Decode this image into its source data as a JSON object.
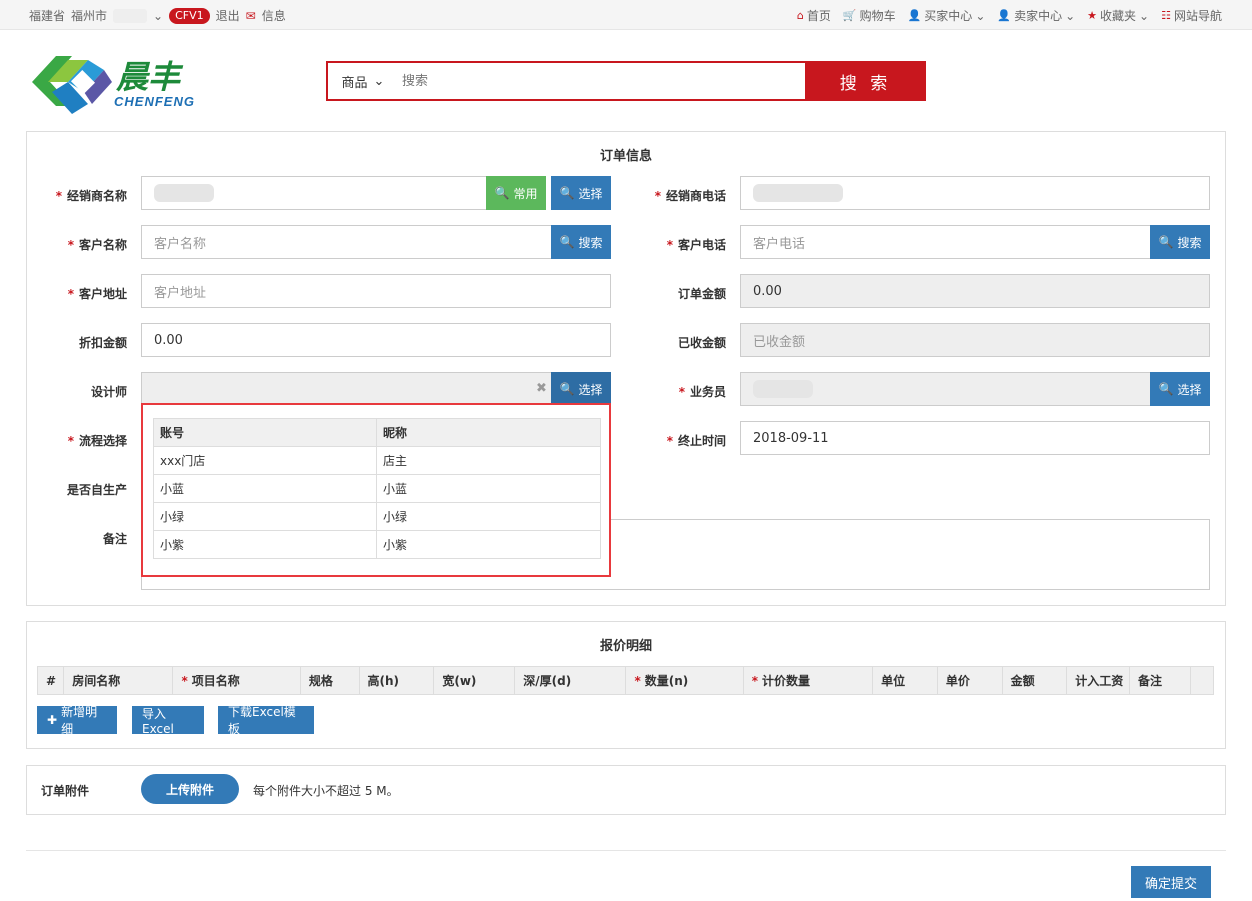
{
  "topbar": {
    "province": "福建省",
    "city": "福州市",
    "badge": "CFV1",
    "logout": "退出",
    "message": "信息",
    "nav": [
      {
        "icon": "home-icon",
        "glyph": "⌂",
        "label": "首页"
      },
      {
        "icon": "cart-icon",
        "glyph": "🛒",
        "label": "购物车"
      },
      {
        "icon": "user-icon",
        "glyph": "👤",
        "label": "买家中心"
      },
      {
        "icon": "user-icon",
        "glyph": "👤",
        "label": "卖家中心"
      },
      {
        "icon": "star-icon",
        "glyph": "★",
        "label": "收藏夹"
      },
      {
        "icon": "grid-icon",
        "glyph": "☷",
        "label": "网站导航"
      }
    ]
  },
  "logo": {
    "cn": "晨丰",
    "en": "CHENFENG"
  },
  "search": {
    "category": "商品",
    "placeholder": "搜索",
    "button": "搜 索"
  },
  "order": {
    "title": "订单信息",
    "dealer_name_label": "经销商名称",
    "dealer_common_btn": "常用",
    "dealer_select_btn": "选择",
    "dealer_phone_label": "经销商电话",
    "customer_name_label": "客户名称",
    "customer_name_placeholder": "客户名称",
    "customer_search_btn": "搜索",
    "customer_phone_label": "客户电话",
    "customer_phone_placeholder": "客户电话",
    "customer_phone_search_btn": "搜索",
    "customer_addr_label": "客户地址",
    "customer_addr_placeholder": "客户地址",
    "order_amount_label": "订单金额",
    "order_amount_value": "0.00",
    "discount_label": "折扣金额",
    "discount_value": "0.00",
    "received_label": "已收金额",
    "received_placeholder": "已收金额",
    "designer_label": "设计师",
    "designer_select_btn": "选择",
    "salesman_label": "业务员",
    "salesman_select_btn": "选择",
    "flow_label": "流程选择",
    "end_time_label": "终止时间",
    "end_time_value": "2018-09-11",
    "self_produce_label": "是否自生产",
    "remark_label": "备注"
  },
  "designer_dropdown": {
    "headers": [
      "账号",
      "昵称"
    ],
    "rows": [
      [
        "xxx门店",
        "店主"
      ],
      [
        "小蓝",
        "小蓝"
      ],
      [
        "小绿",
        "小绿"
      ],
      [
        "小紫",
        "小紫"
      ]
    ]
  },
  "quote": {
    "title": "报价明细",
    "columns": [
      {
        "label": "#",
        "req": false
      },
      {
        "label": "房间名称",
        "req": false
      },
      {
        "label": "项目名称",
        "req": true
      },
      {
        "label": "规格",
        "req": false
      },
      {
        "label": "高(h)",
        "req": false
      },
      {
        "label": "宽(w)",
        "req": false
      },
      {
        "label": "深/厚(d)",
        "req": false
      },
      {
        "label": "数量(n)",
        "req": true
      },
      {
        "label": "计价数量",
        "req": true
      },
      {
        "label": "单位",
        "req": false
      },
      {
        "label": "单价",
        "req": false
      },
      {
        "label": "金额",
        "req": false
      },
      {
        "label": "计入工资",
        "req": false
      },
      {
        "label": "备注",
        "req": false
      },
      {
        "label": "",
        "req": false
      }
    ],
    "add_btn": "新增明细",
    "import_btn": "导入Excel",
    "download_btn": "下载Excel模板"
  },
  "attachment": {
    "label": "订单附件",
    "upload_btn": "上传附件",
    "hint": "每个附件大小不超过 5 M。"
  },
  "submit": "确定提交",
  "colors": {
    "brand_red": "#c8171e",
    "primary_blue": "#337ab7",
    "success_green": "#5cb85c",
    "highlight_red": "#e8393d"
  }
}
